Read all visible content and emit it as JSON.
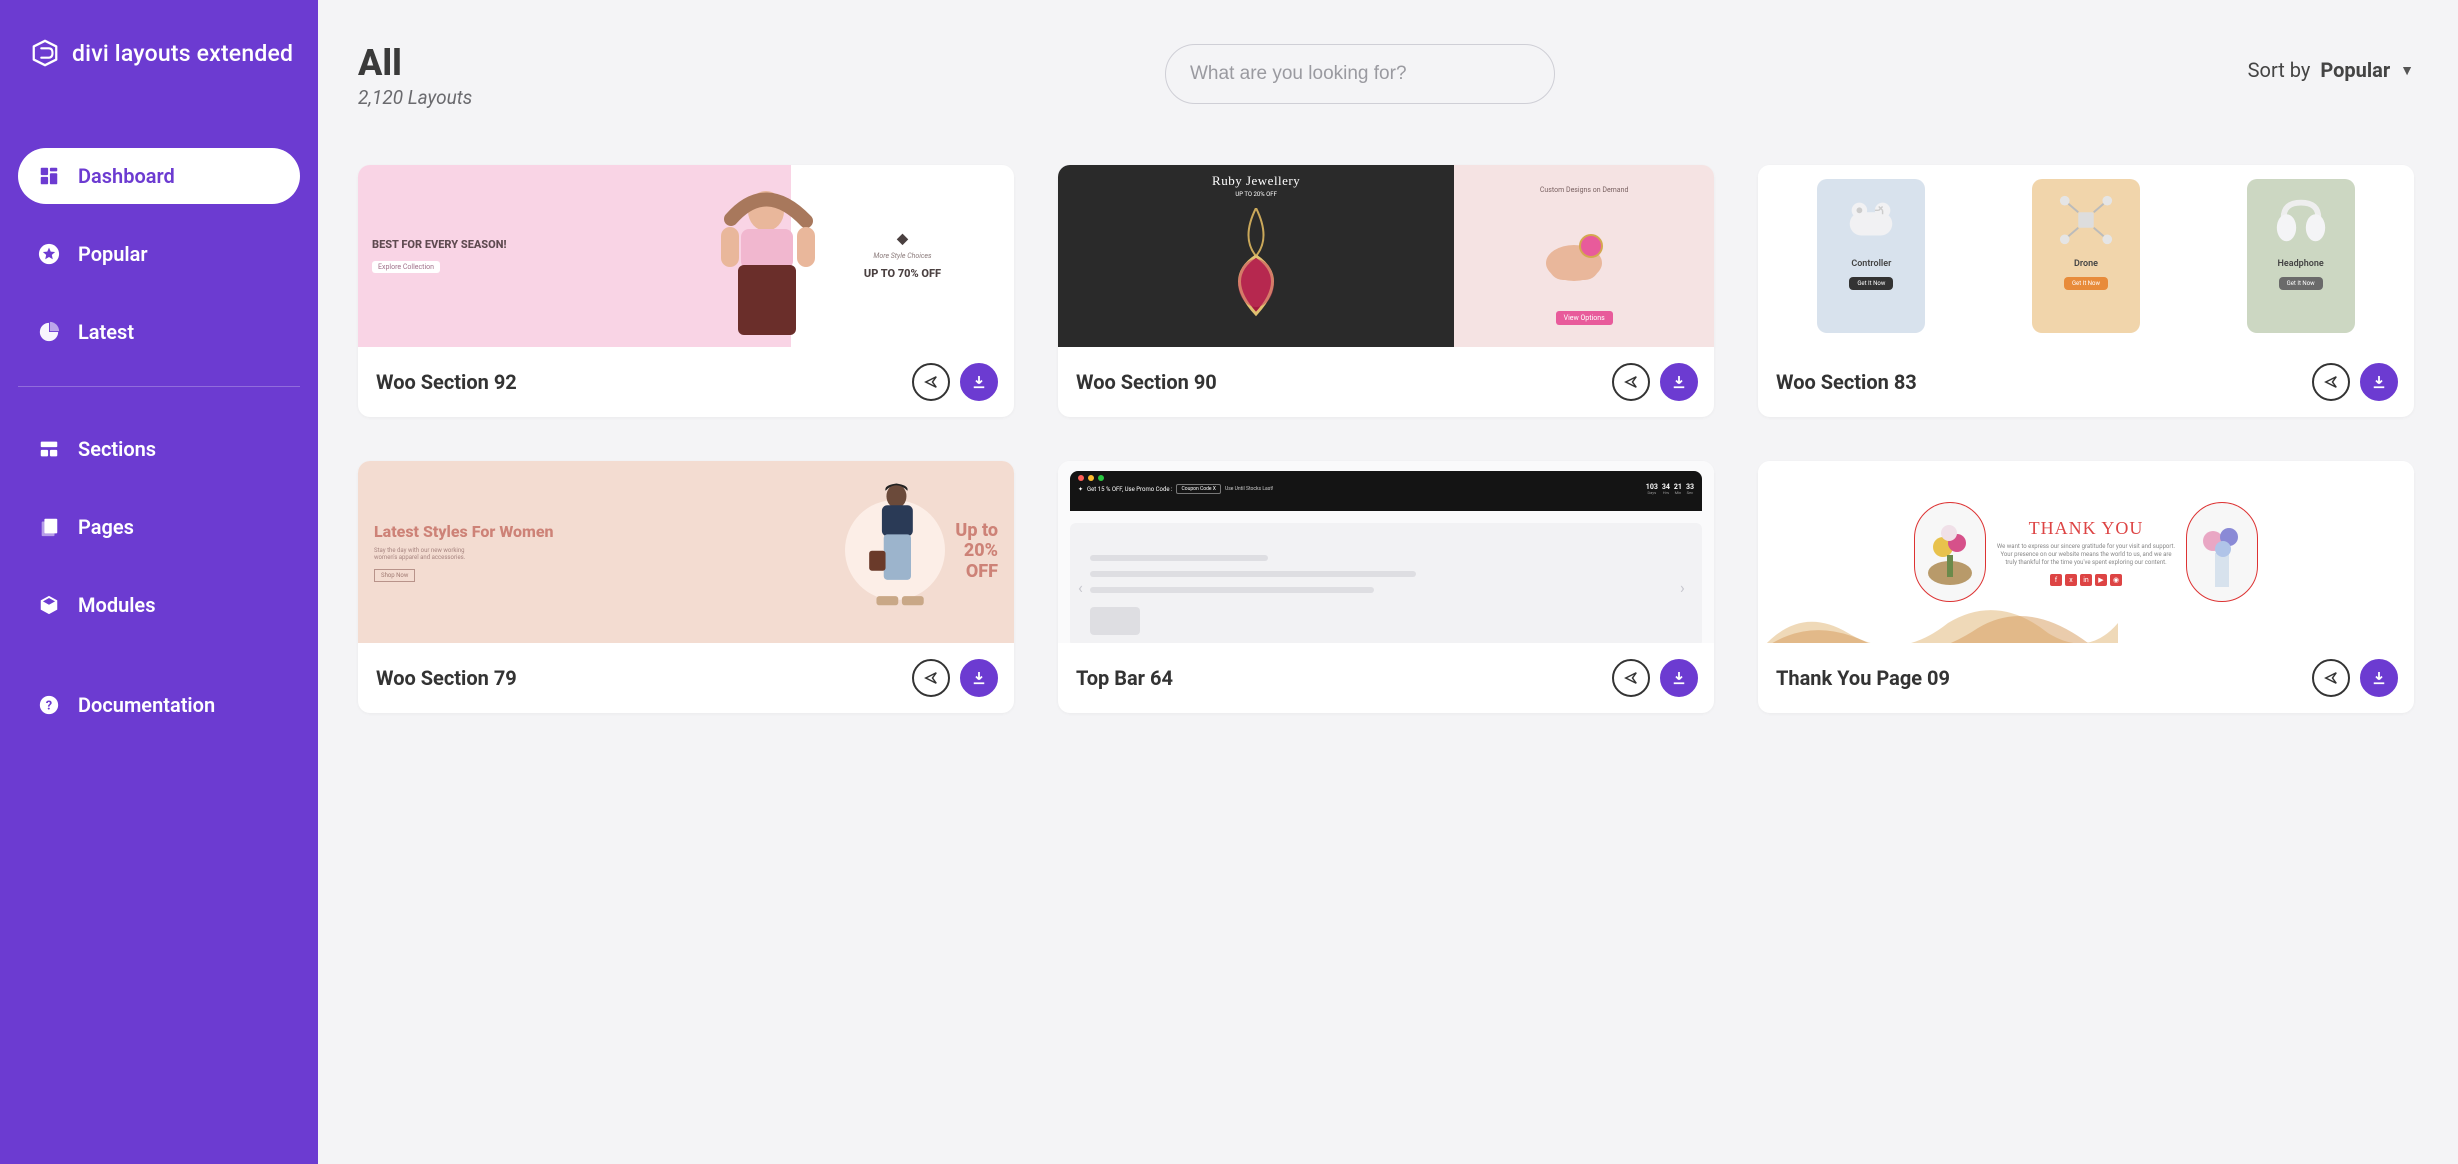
{
  "brand": {
    "name": "divi layouts extended"
  },
  "sidebar": {
    "items": [
      {
        "label": "Dashboard",
        "name": "dashboard",
        "active": true
      },
      {
        "label": "Popular",
        "name": "popular"
      },
      {
        "label": "Latest",
        "name": "latest"
      }
    ],
    "items2": [
      {
        "label": "Sections",
        "name": "sections"
      },
      {
        "label": "Pages",
        "name": "pages"
      },
      {
        "label": "Modules",
        "name": "modules"
      },
      {
        "label": "Documentation",
        "name": "documentation"
      }
    ]
  },
  "header": {
    "title": "All",
    "subtitle": "2,120 Layouts"
  },
  "search": {
    "placeholder": "What are you looking for?"
  },
  "sort": {
    "label": "Sort by",
    "value": "Popular"
  },
  "cards": [
    {
      "title": "Woo Section 92"
    },
    {
      "title": "Woo Section 90"
    },
    {
      "title": "Woo Section 83"
    },
    {
      "title": "Woo Section 79"
    },
    {
      "title": "Top Bar 64"
    },
    {
      "title": "Thank You Page 09"
    }
  ],
  "thumbs": {
    "t1": {
      "heading": "BEST FOR EVERY SEASON!",
      "btn": "Explore Collection",
      "sub": "More Style Choices",
      "off": "UP TO 70% OFF"
    },
    "t2": {
      "title": "Ruby Jewellery",
      "sub": "UP TO 20% OFF",
      "right_title": "Custom Designs on Demand",
      "btn": "View Options"
    },
    "t3": {
      "a": "Controller",
      "abtn": "Get It Now",
      "b": "Drone",
      "bbtn": "Get It Now",
      "c": "Headphone",
      "cbtn": "Get It Now"
    },
    "t4": {
      "heading": "Latest Styles For Women",
      "sub": "Stay the day with our new working women's apparel and accessories.",
      "btn": "Shop Now",
      "off1": "Up to",
      "off2": "20%",
      "off3": "OFF"
    },
    "t5": {
      "promo": "Get 15 % OFF, Use Promo Code :",
      "code": "Coupon Code X",
      "stock": "Use Until Stocks Last!",
      "d": "103",
      "h": "34",
      "m": "21",
      "s": "33",
      "dl": "Days",
      "hl": "Hrs",
      "ml": "Min",
      "sl": "Sec"
    },
    "t6": {
      "title": "THANK YOU",
      "body": "We want to express our sincere gratitude for your visit and support. Your presence on our website means the world to us, and we are truly thankful for the time you've spent exploring our content."
    }
  }
}
